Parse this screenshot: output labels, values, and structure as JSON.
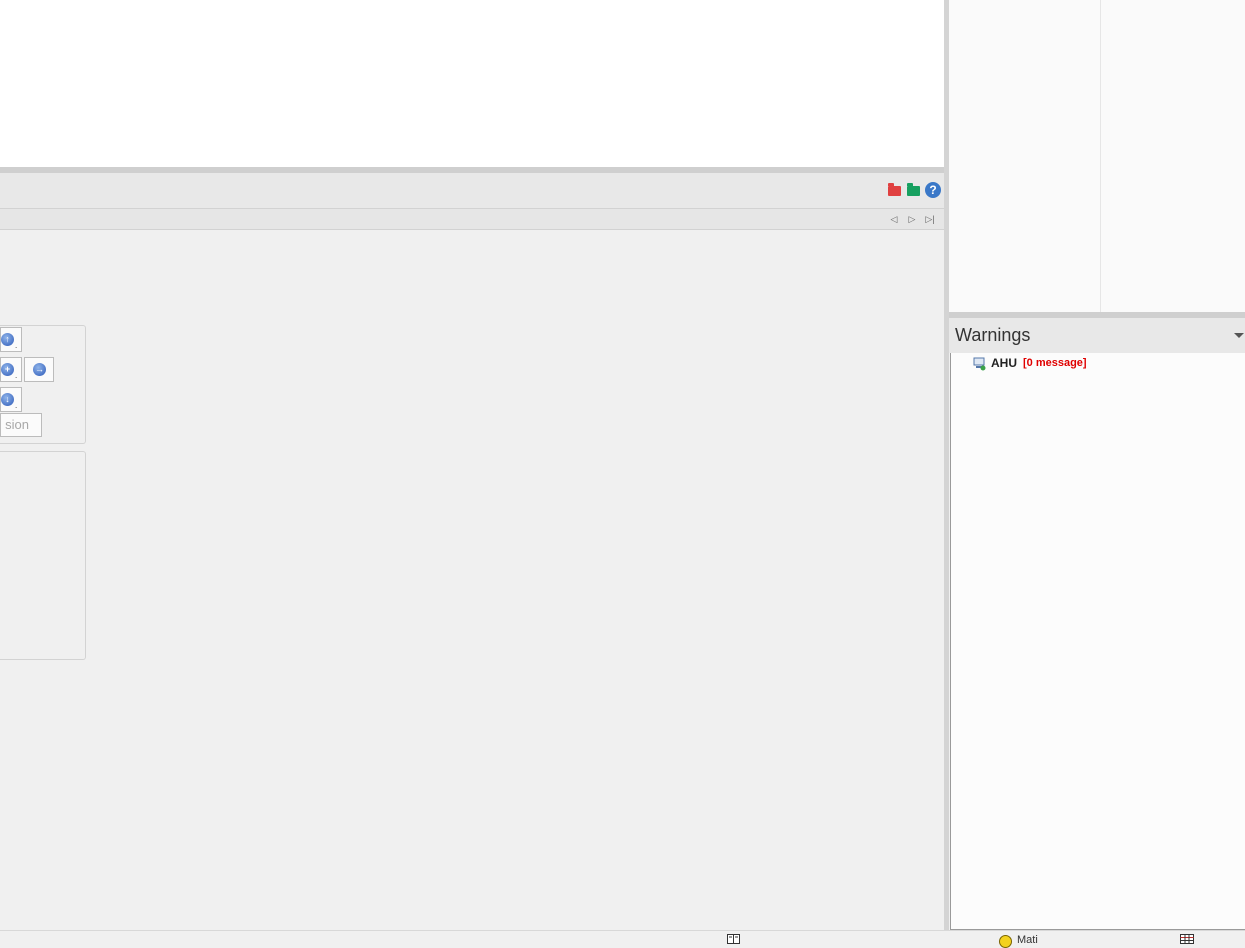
{
  "colors": {
    "folder_red": "#e04040",
    "folder_green": "#17a060",
    "help_blue": "#3a78c8",
    "warning_count": "#e00000"
  },
  "header": {
    "icons": [
      "folder-red-icon",
      "folder-green-icon",
      "help-icon"
    ],
    "help_glyph": "?"
  },
  "tabs": {
    "nav": [
      "◁",
      "▷",
      "▷|"
    ]
  },
  "move_panel": {
    "buttons": [
      "arrow-up-icon",
      "arrow-left-icon",
      "arrow-right-icon",
      "arrow-down-icon"
    ],
    "extrusion_label": "sion"
  },
  "warnings": {
    "title": "Warnings",
    "items": [
      {
        "label": "AHU",
        "count": "[0 message]"
      }
    ]
  },
  "status": {
    "user": "Mati"
  }
}
